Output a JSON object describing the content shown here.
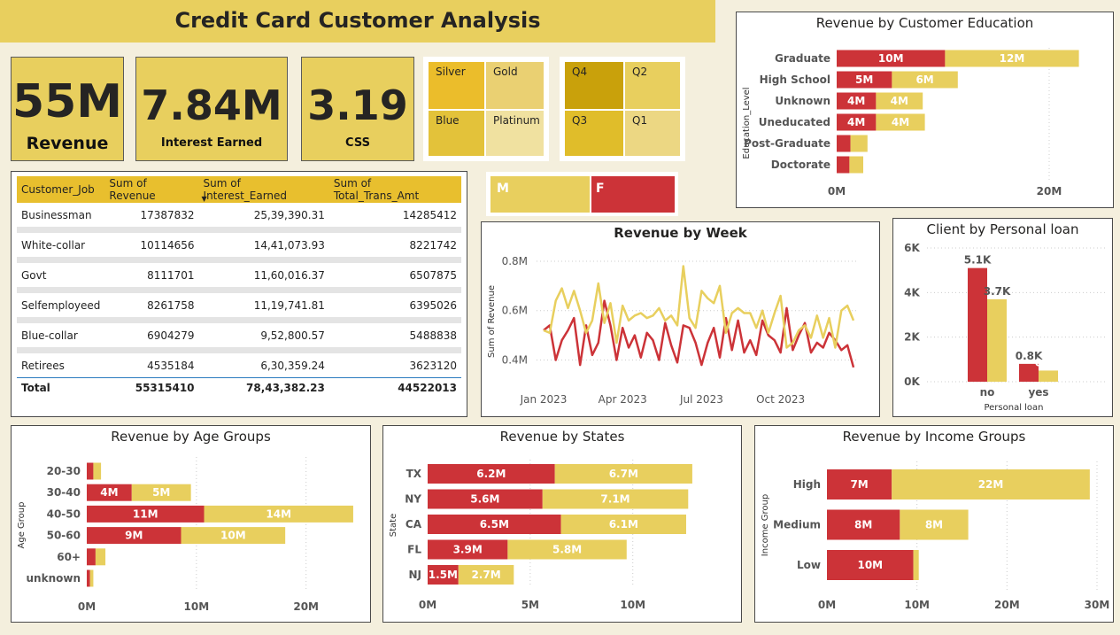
{
  "header": {
    "title": "Credit Card Customer Analysis"
  },
  "kpis": [
    {
      "value": "55M",
      "label": "Revenue"
    },
    {
      "value": "7.84M",
      "label": "Interest Earned"
    },
    {
      "value": "3.19",
      "label": "CSS"
    }
  ],
  "card_slicer": {
    "labels": [
      "Silver",
      "Gold",
      "Blue",
      "Platinum"
    ]
  },
  "quarter_slicer": {
    "labels": [
      "Q4",
      "Q2",
      "Q3",
      "Q1"
    ]
  },
  "gender_slicer": {
    "labels": [
      "M",
      "F"
    ]
  },
  "colors": {
    "female": "#cc3338",
    "male": "#e8cf5e",
    "header_band": "#e8cf5e"
  },
  "table": {
    "headers": [
      "Customer_Job",
      "Sum of Revenue",
      "Sum of Interest_Earned",
      "Sum of Total_Trans_Amt"
    ],
    "rows": [
      [
        "Businessman",
        "17387832",
        "25,39,390.31",
        "14285412"
      ],
      [
        "White-collar",
        "10114656",
        "14,41,073.93",
        "8221742"
      ],
      [
        "Govt",
        "8111701",
        "11,60,016.37",
        "6507875"
      ],
      [
        "Selfemployeed",
        "8261758",
        "11,19,741.81",
        "6395026"
      ],
      [
        "Blue-collar",
        "6904279",
        "9,52,800.57",
        "5488838"
      ],
      [
        "Retirees",
        "4535184",
        "6,30,359.24",
        "3623120"
      ]
    ],
    "total": [
      "Total",
      "55315410",
      "78,43,382.23",
      "44522013"
    ]
  },
  "chart_data": [
    {
      "id": "education",
      "type": "bar",
      "orientation": "horizontal",
      "stacked": true,
      "title": "Revenue by Customer Education",
      "ylabel": "Education_Level",
      "categories": [
        "Graduate",
        "High School",
        "Unknown",
        "Uneducated",
        "Post-Graduate",
        "Doctorate"
      ],
      "series": [
        {
          "values": [
            10.2,
            5.2,
            3.7,
            3.7,
            1.3,
            1.2
          ],
          "labels": [
            "10M",
            "5M",
            "4M",
            "4M",
            "",
            ""
          ]
        },
        {
          "values": [
            12.6,
            6.2,
            4.4,
            4.6,
            1.6,
            1.3
          ],
          "labels": [
            "12M",
            "6M",
            "4M",
            "4M",
            "",
            ""
          ]
        }
      ],
      "xticks": [
        "0M",
        "20M"
      ],
      "xlim": [
        0,
        25
      ]
    },
    {
      "id": "week",
      "type": "line",
      "title": "Revenue by Week",
      "ylabel": "Sum of Revenue",
      "yticks": [
        "0.4M",
        "0.6M",
        "0.8M"
      ],
      "ylim": [
        0.33,
        0.85
      ],
      "xticks": [
        "Jan 2023",
        "Apr 2023",
        "Jul 2023",
        "Oct 2023"
      ],
      "x": [
        "2023-01-01",
        "2023-01-08",
        "2023-01-15",
        "2023-01-22",
        "2023-01-29",
        "2023-02-05",
        "2023-02-12",
        "2023-02-19",
        "2023-02-26",
        "2023-03-05",
        "2023-03-12",
        "2023-03-19",
        "2023-03-26",
        "2023-04-02",
        "2023-04-09",
        "2023-04-16",
        "2023-04-23",
        "2023-04-30",
        "2023-05-07",
        "2023-05-14",
        "2023-05-21",
        "2023-05-28",
        "2023-06-04",
        "2023-06-11",
        "2023-06-18",
        "2023-06-25",
        "2023-07-02",
        "2023-07-09",
        "2023-07-16",
        "2023-07-23",
        "2023-07-30",
        "2023-08-06",
        "2023-08-13",
        "2023-08-20",
        "2023-08-27",
        "2023-09-03",
        "2023-09-10",
        "2023-09-17",
        "2023-09-24",
        "2023-10-01",
        "2023-10-08",
        "2023-10-15",
        "2023-10-22",
        "2023-10-29",
        "2023-11-05",
        "2023-11-12",
        "2023-11-19",
        "2023-11-26",
        "2023-12-03",
        "2023-12-10",
        "2023-12-17",
        "2023-12-24"
      ],
      "series": [
        {
          "values": [
            0.52,
            0.54,
            0.4,
            0.48,
            0.52,
            0.57,
            0.38,
            0.54,
            0.42,
            0.47,
            0.64,
            0.54,
            0.4,
            0.53,
            0.45,
            0.5,
            0.41,
            0.51,
            0.48,
            0.4,
            0.55,
            0.46,
            0.39,
            0.54,
            0.53,
            0.47,
            0.38,
            0.47,
            0.53,
            0.41,
            0.57,
            0.44,
            0.56,
            0.43,
            0.48,
            0.42,
            0.56,
            0.5,
            0.48,
            0.43,
            0.61,
            0.44,
            0.5,
            0.55,
            0.43,
            0.47,
            0.45,
            0.51,
            0.48,
            0.44,
            0.46,
            0.37
          ]
        },
        {
          "values": [
            0.52,
            0.51,
            0.64,
            0.69,
            0.61,
            0.68,
            0.6,
            0.51,
            0.56,
            0.71,
            0.55,
            0.63,
            0.47,
            0.62,
            0.56,
            0.58,
            0.59,
            0.57,
            0.58,
            0.61,
            0.56,
            0.58,
            0.54,
            0.78,
            0.57,
            0.53,
            0.68,
            0.65,
            0.63,
            0.7,
            0.51,
            0.59,
            0.61,
            0.59,
            0.59,
            0.53,
            0.6,
            0.51,
            0.59,
            0.66,
            0.45,
            0.47,
            0.52,
            0.54,
            0.49,
            0.58,
            0.49,
            0.57,
            0.45,
            0.6,
            0.62,
            0.56
          ]
        }
      ]
    },
    {
      "id": "personal_loan",
      "type": "bar",
      "title": "Client by Personal loan",
      "xlabel": "Personal loan",
      "categories": [
        "no",
        "yes"
      ],
      "series": [
        {
          "values": [
            5.1,
            0.8
          ],
          "labels": [
            "5.1K",
            "0.8K"
          ]
        },
        {
          "values": [
            3.7,
            0.5
          ],
          "labels": [
            "3.7K",
            "0.5K"
          ]
        }
      ],
      "yticks": [
        "0K",
        "2K",
        "4K",
        "6K"
      ],
      "ylim": [
        0,
        6
      ]
    },
    {
      "id": "age",
      "type": "bar",
      "orientation": "horizontal",
      "stacked": true,
      "title": "Revenue by Age Groups",
      "ylabel": "Age Group",
      "categories": [
        "20-30",
        "30-40",
        "40-50",
        "50-60",
        "60+",
        "unknown"
      ],
      "series": [
        {
          "values": [
            0.6,
            4.1,
            10.7,
            8.6,
            0.8,
            0.3
          ],
          "labels": [
            "",
            "4M",
            "11M",
            "9M",
            "",
            ""
          ]
        },
        {
          "values": [
            0.7,
            5.4,
            13.6,
            9.5,
            0.9,
            0.3
          ],
          "labels": [
            "",
            "5M",
            "14M",
            "10M",
            "",
            ""
          ]
        }
      ],
      "xticks": [
        "0M",
        "10M",
        "20M"
      ],
      "xlim": [
        0,
        26
      ]
    },
    {
      "id": "states",
      "type": "bar",
      "orientation": "horizontal",
      "stacked": true,
      "title": "Revenue by States",
      "ylabel": "State",
      "categories": [
        "TX",
        "NY",
        "CA",
        "FL",
        "NJ"
      ],
      "series": [
        {
          "values": [
            6.2,
            5.6,
            6.5,
            3.9,
            1.5
          ],
          "labels": [
            "6.2M",
            "5.6M",
            "6.5M",
            "3.9M",
            "1.5M"
          ]
        },
        {
          "values": [
            6.7,
            7.1,
            6.1,
            5.8,
            2.7
          ],
          "labels": [
            "6.7M",
            "7.1M",
            "6.1M",
            "5.8M",
            "2.7M"
          ]
        }
      ],
      "xticks": [
        "0M",
        "5M",
        "10M"
      ],
      "xlim": [
        0,
        14.5
      ]
    },
    {
      "id": "income",
      "type": "bar",
      "orientation": "horizontal",
      "stacked": true,
      "title": "Revenue by Income Groups",
      "ylabel": "Income Group",
      "categories": [
        "High",
        "Medium",
        "Low"
      ],
      "series": [
        {
          "values": [
            7.2,
            8.1,
            9.6
          ],
          "labels": [
            "7M",
            "8M",
            "10M"
          ]
        },
        {
          "values": [
            22.0,
            7.6,
            0.6
          ],
          "labels": [
            "22M",
            "8M",
            ""
          ]
        }
      ],
      "xticks": [
        "0M",
        "10M",
        "20M",
        "30M"
      ],
      "xlim": [
        0,
        30
      ]
    }
  ]
}
